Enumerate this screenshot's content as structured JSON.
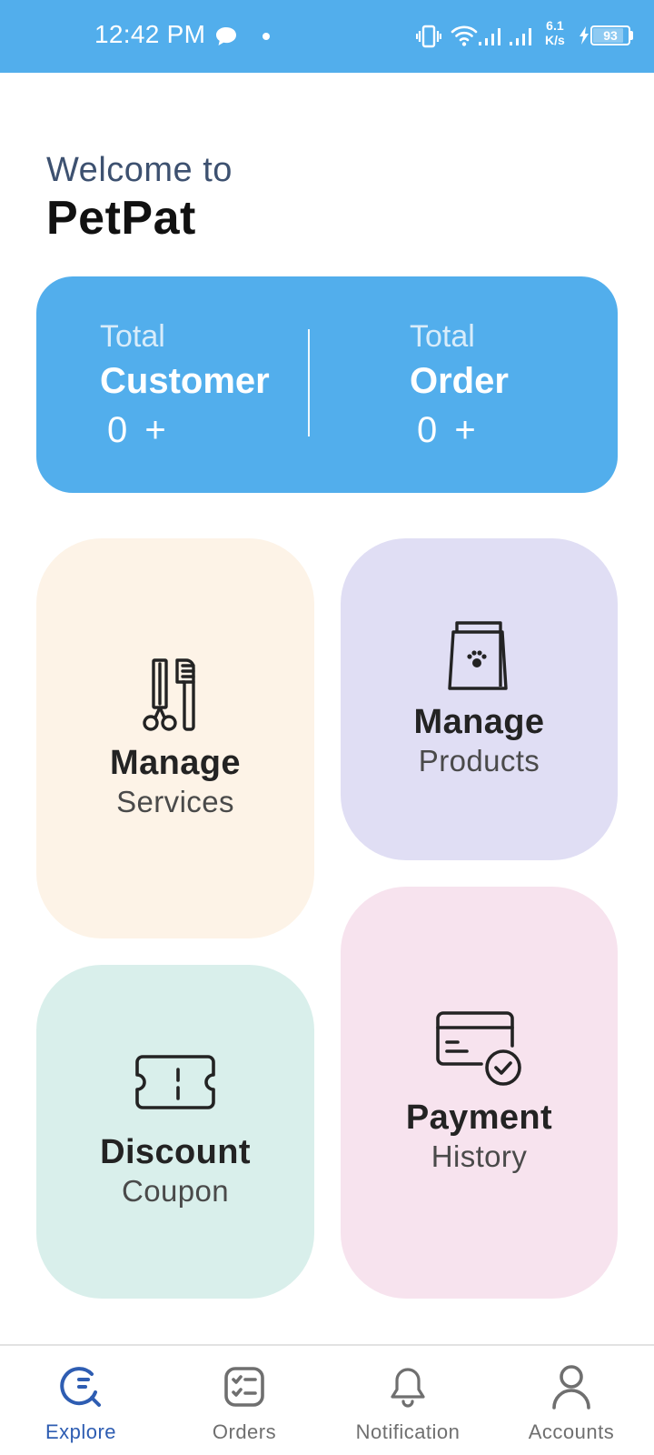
{
  "status_bar": {
    "time": "12:42 PM",
    "speed_value": "6.1",
    "speed_unit": "K/s",
    "battery": "93",
    "battery_level": 0.93,
    "icons": [
      "chat-bubble-icon",
      "notification-dot-icon",
      "vibrate-icon",
      "wifi-icon",
      "signal-icon",
      "signal-icon",
      "charging-bolt-icon",
      "battery-icon"
    ]
  },
  "header": {
    "welcome": "Welcome to",
    "app_name": "PetPat"
  },
  "stats": {
    "customer": {
      "caption": "Total",
      "title": "Customer",
      "value": "0 +"
    },
    "order": {
      "caption": "Total",
      "title": "Order",
      "value": "0 +"
    }
  },
  "tiles": {
    "services": {
      "title": "Manage",
      "subtitle": "Services",
      "icon": "grooming-tools-icon",
      "color": "#fdf3e7"
    },
    "products": {
      "title": "Manage",
      "subtitle": "Products",
      "icon": "pet-food-bag-icon",
      "color": "#e0def4"
    },
    "coupon": {
      "title": "Discount",
      "subtitle": "Coupon",
      "icon": "ticket-icon",
      "color": "#d9efeb"
    },
    "payment": {
      "title": "Payment",
      "subtitle": "History",
      "icon": "card-check-icon",
      "color": "#f7e3ee"
    }
  },
  "nav": {
    "items": [
      {
        "label": "Explore",
        "icon": "explore-search-icon",
        "active": true
      },
      {
        "label": "Orders",
        "icon": "checklist-icon",
        "active": false
      },
      {
        "label": "Notification",
        "icon": "bell-icon",
        "active": false
      },
      {
        "label": "Accounts",
        "icon": "user-icon",
        "active": false
      }
    ]
  },
  "colors": {
    "primary": "#52aeec",
    "nav_active": "#2e5db2",
    "nav_inactive": "#6f6f6f"
  }
}
